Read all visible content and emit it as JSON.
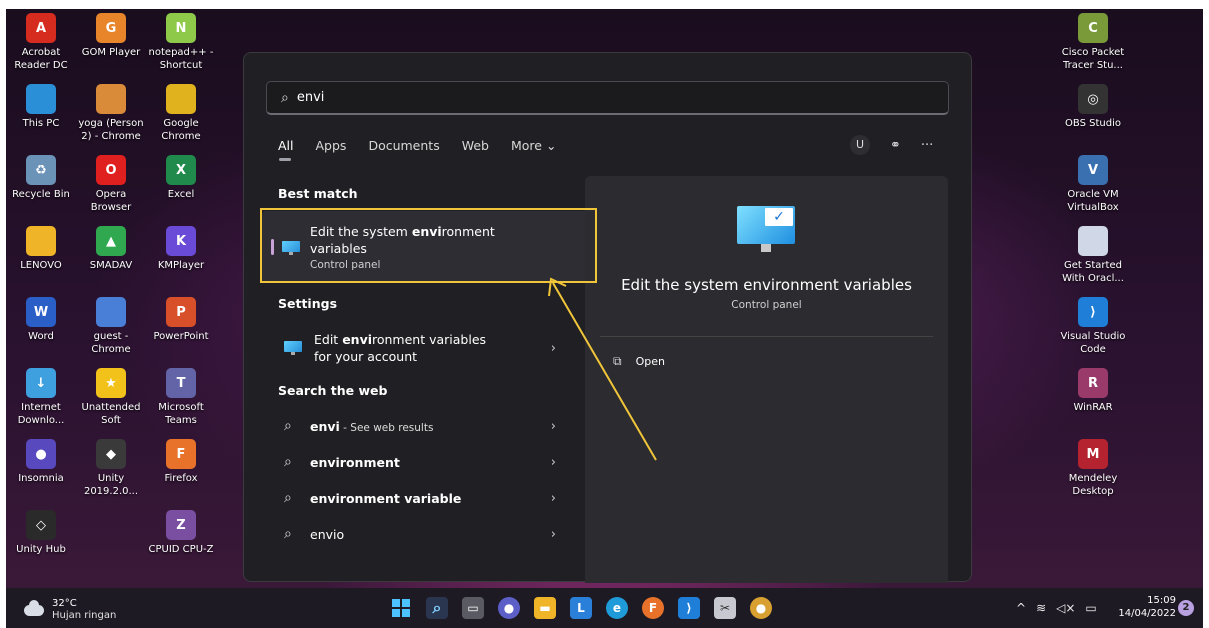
{
  "desktop_left": [
    {
      "label": "Acrobat\nReader DC",
      "icon": "acrobat-icon",
      "color": "#d62b1f",
      "glyph": "A"
    },
    {
      "label": "GOM Player",
      "icon": "gom-player-icon",
      "color": "#e8842a",
      "glyph": "G"
    },
    {
      "label": "notepad++ -\nShortcut",
      "icon": "notepad-plus-icon",
      "color": "#8fc94a",
      "glyph": "N"
    },
    {
      "label": "This PC",
      "icon": "this-pc-icon",
      "color": "#2b8fd8",
      "glyph": ""
    },
    {
      "label": "yoga (Person\n2) - Chrome",
      "icon": "chrome-profile-icon",
      "color": "#d98b3a",
      "glyph": ""
    },
    {
      "label": "Google\nChrome",
      "icon": "chrome-icon",
      "color": "#e0b21e",
      "glyph": ""
    },
    {
      "label": "Recycle Bin",
      "icon": "recycle-bin-icon",
      "color": "#6b93b8",
      "glyph": "♻"
    },
    {
      "label": "Opera\nBrowser",
      "icon": "opera-icon",
      "color": "#e0201f",
      "glyph": "O"
    },
    {
      "label": "Excel",
      "icon": "excel-icon",
      "color": "#1f8a4c",
      "glyph": "X"
    },
    {
      "label": "LENOVO",
      "icon": "folder-icon",
      "color": "#f0b429",
      "glyph": ""
    },
    {
      "label": "SMADAV",
      "icon": "smadav-icon",
      "color": "#2fa84f",
      "glyph": "▲"
    },
    {
      "label": "KMPlayer",
      "icon": "kmplayer-icon",
      "color": "#6a4bd8",
      "glyph": "K"
    },
    {
      "label": "Word",
      "icon": "word-icon",
      "color": "#2a5fc8",
      "glyph": "W"
    },
    {
      "label": "guest -\nChrome",
      "icon": "chrome-guest-icon",
      "color": "#4a7fd8",
      "glyph": ""
    },
    {
      "label": "PowerPoint",
      "icon": "powerpoint-icon",
      "color": "#d8502a",
      "glyph": "P"
    },
    {
      "label": "Internet\nDownlo...",
      "icon": "idm-icon",
      "color": "#3fa0e0",
      "glyph": "↓"
    },
    {
      "label": "Unattended\nSoft",
      "icon": "star-icon",
      "color": "#f2c21b",
      "glyph": "★"
    },
    {
      "label": "Microsoft\nTeams",
      "icon": "teams-icon",
      "color": "#6264a7",
      "glyph": "T"
    },
    {
      "label": "Insomnia",
      "icon": "insomnia-icon",
      "color": "#5849be",
      "glyph": "●"
    },
    {
      "label": "Unity\n2019.2.0...",
      "icon": "unity-icon",
      "color": "#3a3a3a",
      "glyph": "◆"
    },
    {
      "label": "Firefox",
      "icon": "firefox-icon",
      "color": "#e8722a",
      "glyph": "F"
    },
    {
      "label": "Unity Hub",
      "icon": "unity-hub-icon",
      "color": "#2a2a2a",
      "glyph": "◇"
    },
    {
      "label": "",
      "icon": "blank-icon",
      "color": "transparent",
      "glyph": ""
    },
    {
      "label": "CPUID CPU-Z",
      "icon": "cpuz-icon",
      "color": "#7a4ea0",
      "glyph": "Z"
    }
  ],
  "desktop_right": [
    {
      "label": "Cisco Packet\nTracer Stu...",
      "icon": "cisco-packet-tracer-icon",
      "color": "#7a9a3a",
      "glyph": "C"
    },
    {
      "label": "OBS Studio",
      "icon": "obs-icon",
      "color": "#333333",
      "glyph": "◎"
    },
    {
      "label": "Oracle VM\nVirtualBox",
      "icon": "virtualbox-icon",
      "color": "#3a6fb0",
      "glyph": "V"
    },
    {
      "label": "Get Started\nWith Oracl...",
      "icon": "virtualbox-doc-icon",
      "color": "#d0d8e8",
      "glyph": ""
    },
    {
      "label": "Visual Studio\nCode",
      "icon": "vscode-icon",
      "color": "#1f7fd8",
      "glyph": "⟩"
    },
    {
      "label": "WinRAR",
      "icon": "winrar-icon",
      "color": "#9a3a6a",
      "glyph": "R"
    },
    {
      "label": "Mendeley\nDesktop",
      "icon": "mendeley-icon",
      "color": "#b4232f",
      "glyph": "M"
    }
  ],
  "search": {
    "query": "envi",
    "filters": [
      "All",
      "Apps",
      "Documents",
      "Web",
      "More ⌄"
    ],
    "user_initial": "U",
    "best_match_heading": "Best match",
    "best_match": {
      "title_before": "Edit the system ",
      "title_bold": "envi",
      "title_after": "ronment variables",
      "subtitle": "Control panel"
    },
    "settings_heading": "Settings",
    "settings_item": {
      "before": "Edit ",
      "bold": "envi",
      "after": "ronment variables for your account"
    },
    "web_heading": "Search the web",
    "web_items": [
      {
        "bold": "envi",
        "rest": " - See web results"
      },
      {
        "bold": "",
        "rest": "environment",
        "boldall": "environment"
      },
      {
        "bold": "",
        "rest": "environment variable",
        "boldall": "environment variable"
      },
      {
        "bold": "",
        "rest": "envio",
        "boldall": ""
      }
    ]
  },
  "detail": {
    "title": "Edit the system environment variables",
    "subtitle": "Control panel",
    "open_label": "Open"
  },
  "taskbar": {
    "temperature": "32°C",
    "weather": "Hujan ringan",
    "time": "15:09",
    "date": "14/04/2022",
    "notification_count": "2"
  }
}
